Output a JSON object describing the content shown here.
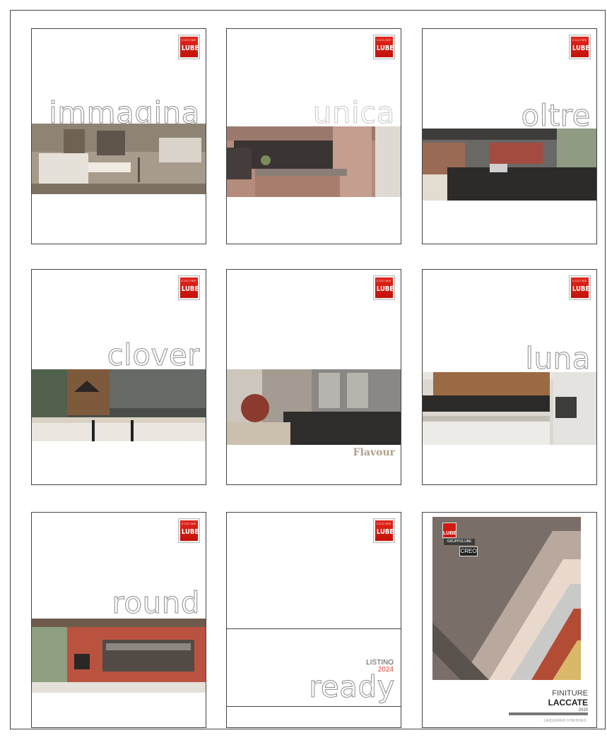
{
  "brand": {
    "top": "CUCINE",
    "name": "LUBE"
  },
  "catalogs": [
    {
      "title": "immagina"
    },
    {
      "title": "unica"
    },
    {
      "title": "oltre"
    },
    {
      "title": "clover"
    },
    {
      "subtitle": "Flavour"
    },
    {
      "title": "luna"
    },
    {
      "title": "round"
    },
    {
      "listino": "LISTINO",
      "year": "2024",
      "title": "ready"
    },
    {
      "gruppo": "GRUPPOLUBE",
      "creo": "CREO",
      "finiture": "FINITURE",
      "laccate": "LACCATE",
      "year": "2020",
      "tagline": "LAQUERED FINISHES"
    }
  ],
  "colors": {
    "brand_red": "#d01a12",
    "frame": "#444444",
    "title_stroke": "#8d8d8d"
  }
}
